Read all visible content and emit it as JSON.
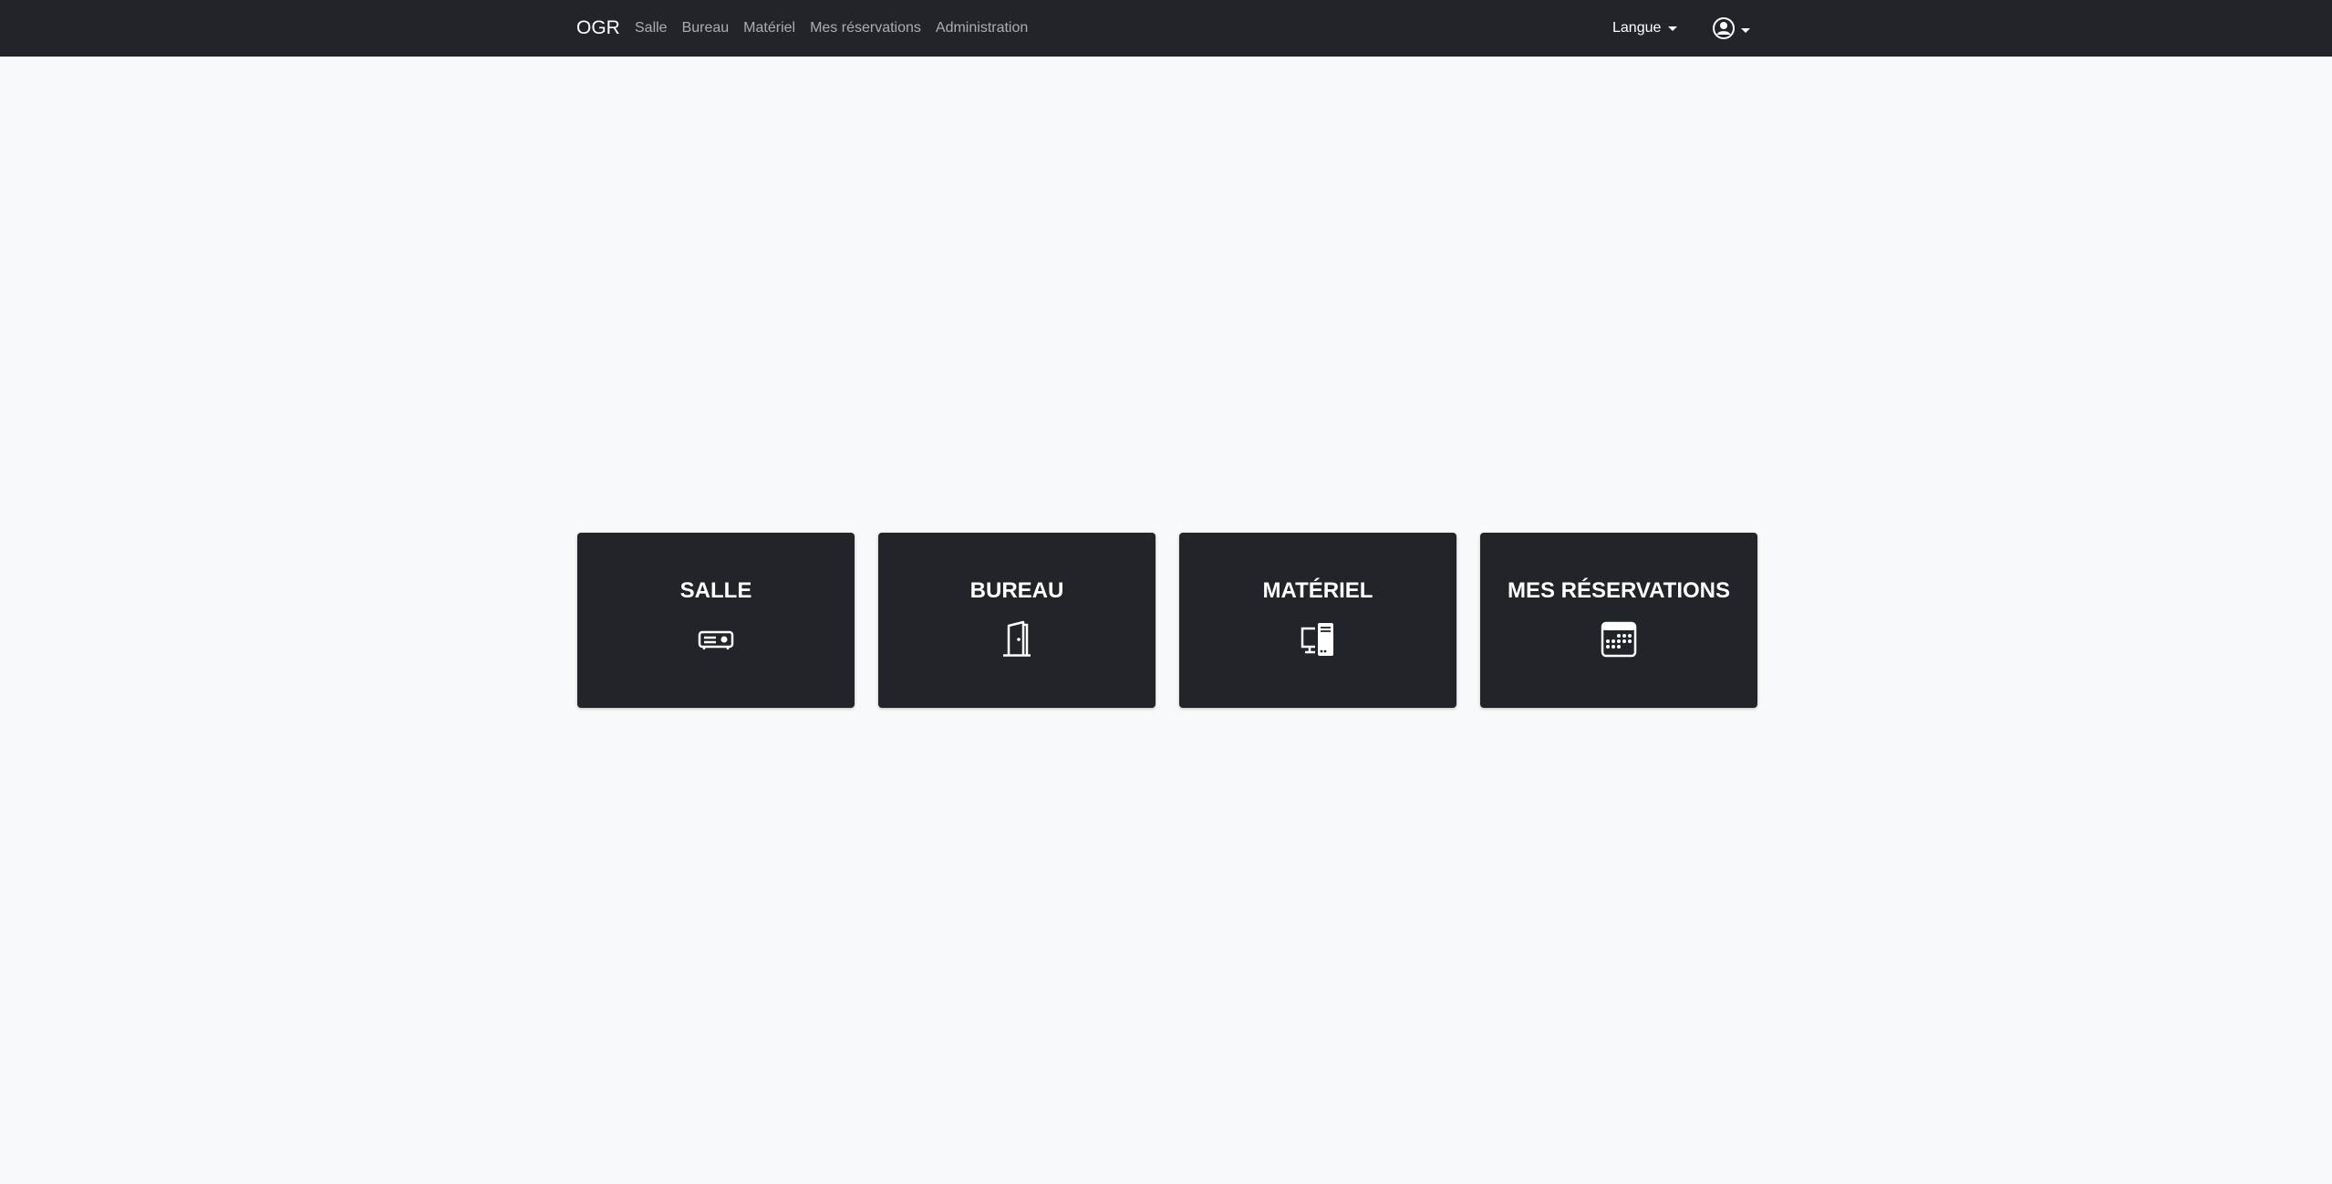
{
  "navbar": {
    "brand": "OGR",
    "links": [
      "Salle",
      "Bureau",
      "Matériel",
      "Mes réservations",
      "Administration"
    ],
    "language_label": "Langue",
    "user_icon": "user-circle-icon"
  },
  "cards": [
    {
      "title": "SALLE",
      "icon": "projector-icon"
    },
    {
      "title": "BUREAU",
      "icon": "door-icon"
    },
    {
      "title": "MATÉRIEL",
      "icon": "pc-display-icon"
    },
    {
      "title": "MES RÉSERVATIONS",
      "icon": "calendar-icon"
    }
  ],
  "colors": {
    "navbar_bg": "#212529",
    "page_bg": "#f8f9fa",
    "card_bg": "#212529",
    "text": "#ffffff"
  }
}
